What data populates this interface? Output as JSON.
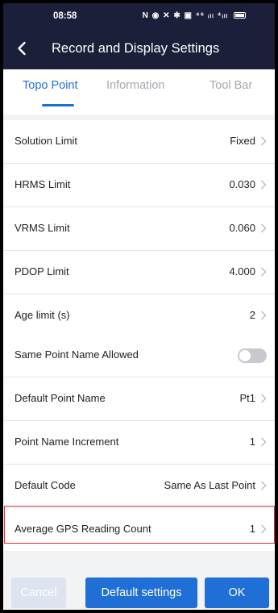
{
  "status_bar": {
    "time": "08:58",
    "icons": "N ◉ ✕ ✱ ▣ ⁴⁶ ᵢₗₗ ⁴ᵢₗₗ"
  },
  "header": {
    "title": "Record and Display Settings"
  },
  "tabs": [
    {
      "label": "Topo Point",
      "active": true
    },
    {
      "label": "Information",
      "active": false
    },
    {
      "label": "Tool Bar",
      "active": false
    }
  ],
  "group1": [
    {
      "label": "Solution Limit",
      "value": "Fixed"
    },
    {
      "label": "HRMS Limit",
      "value": "0.030"
    },
    {
      "label": "VRMS Limit",
      "value": "0.060"
    },
    {
      "label": "PDOP Limit",
      "value": "4.000"
    },
    {
      "label": "Age limit (s)",
      "value": "2"
    }
  ],
  "group2": {
    "same_point_name": {
      "label": "Same Point Name Allowed",
      "enabled": false
    },
    "rows": [
      {
        "label": "Default Point Name",
        "value": "Pt1"
      },
      {
        "label": "Point Name Increment",
        "value": "1"
      },
      {
        "label": "Default Code",
        "value": "Same As Last Point"
      },
      {
        "label": "Average GPS Reading Count",
        "value": "1"
      }
    ]
  },
  "buttons": {
    "cancel": "Cancel",
    "default_settings": "Default settings",
    "ok": "OK"
  },
  "colors": {
    "header_bg": "#1b1f3a",
    "accent": "#1f6fd6",
    "highlight_border": "#e0303c"
  }
}
